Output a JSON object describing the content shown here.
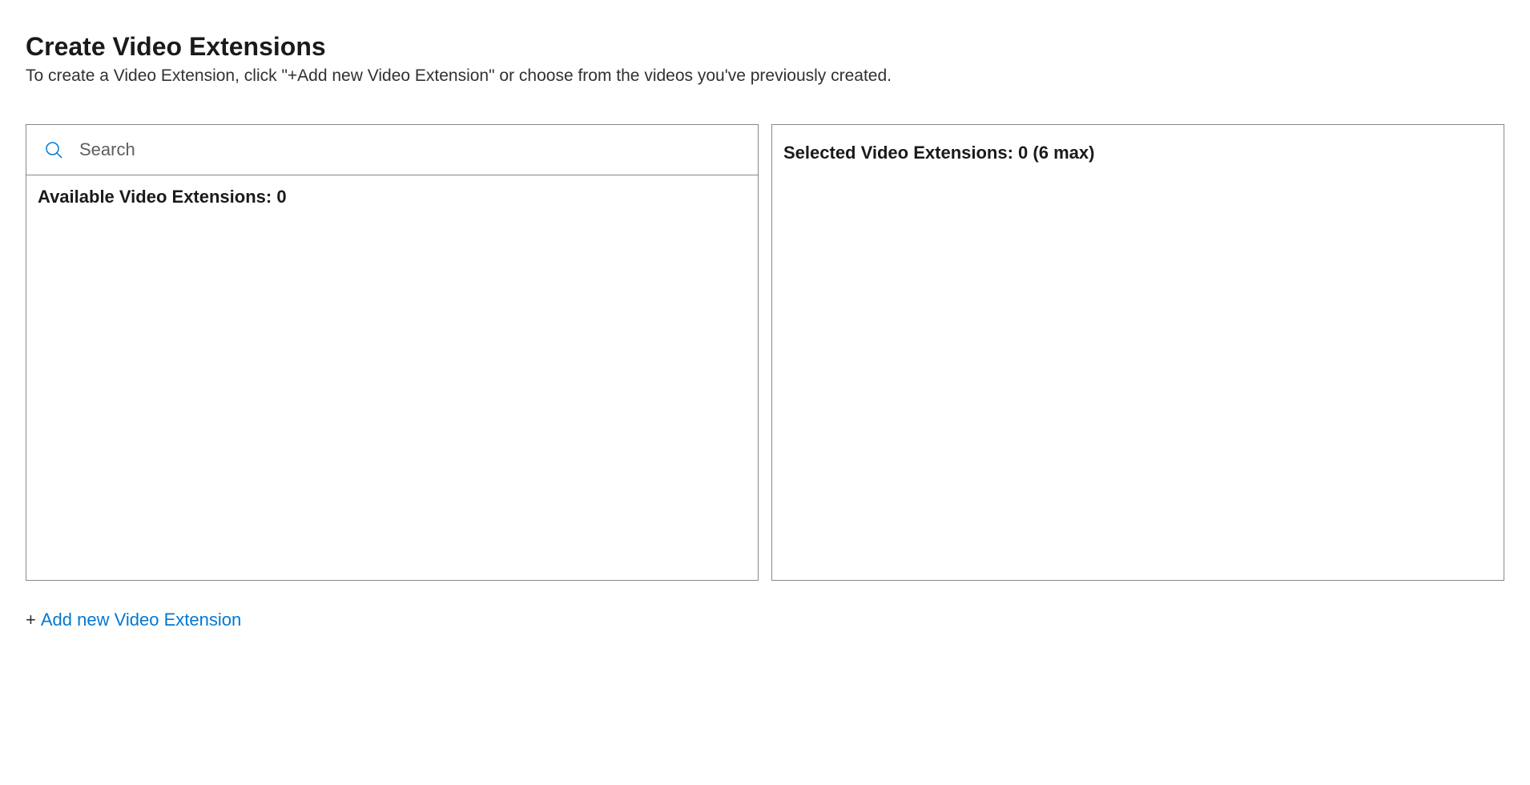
{
  "header": {
    "title": "Create Video Extensions",
    "subtitle": "To create a Video Extension, click \"+Add new Video Extension\" or choose from the videos you've previously created."
  },
  "search": {
    "placeholder": "Search",
    "value": ""
  },
  "available": {
    "label_prefix": "Available Video Extensions:  ",
    "count": "0"
  },
  "selected": {
    "label_prefix": "Selected Video Extensions:  ",
    "count": "0",
    "max_suffix": " (6 max)"
  },
  "add_new": {
    "plus": "+",
    "label": "Add new Video Extension"
  }
}
